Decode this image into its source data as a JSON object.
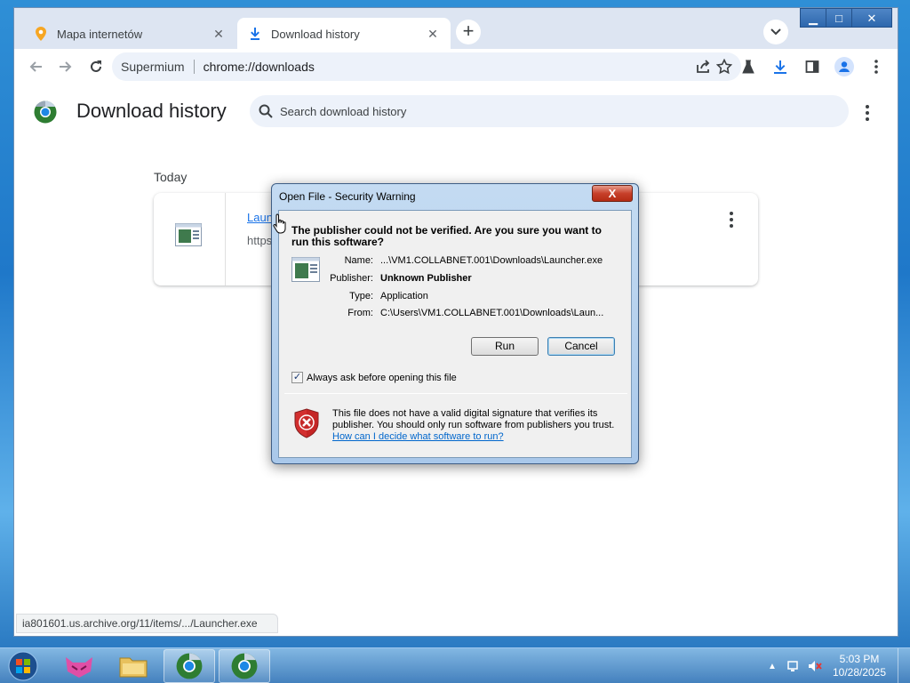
{
  "tabs": [
    {
      "title": "Mapa internetów",
      "icon": "map-pin-icon",
      "active": false
    },
    {
      "title": "Download history",
      "icon": "download-icon",
      "active": true
    }
  ],
  "toolbar": {
    "site_label": "Supermium",
    "url": "chrome://downloads"
  },
  "page": {
    "title": "Download history",
    "search_placeholder": "Search download history",
    "date_group": "Today",
    "download": {
      "filename": "Laun",
      "url": "https:"
    }
  },
  "status_bar": {
    "text": "ia801601.us.archive.org/11/items/.../Launcher.exe"
  },
  "dialog": {
    "title": "Open File - Security Warning",
    "close": "X",
    "heading": "The publisher could not be verified.  Are you sure you want to run this software?",
    "fields": [
      {
        "label": "Name:",
        "value": "...\\VM1.COLLABNET.001\\Downloads\\Launcher.exe"
      },
      {
        "label": "Publisher:",
        "value": "Unknown Publisher"
      },
      {
        "label": "Type:",
        "value": "Application"
      },
      {
        "label": "From:",
        "value": "C:\\Users\\VM1.COLLABNET.001\\Downloads\\Laun..."
      }
    ],
    "run_label": "Run",
    "cancel_label": "Cancel",
    "checkbox_label": "Always ask before opening this file",
    "checkbox_checked": true,
    "warning_text": "This file does not have a valid digital signature that verifies its publisher.  You should only run software from publishers you trust.",
    "warning_link": "How can I decide what software to run?"
  },
  "taskbar": {
    "time": "5:03 PM",
    "date": "10/28/2025"
  },
  "colors": {
    "accent": "#1a73e8",
    "omnibox_bg": "#edf2fa",
    "dialog_frame": "#a9c8ea",
    "taskbar": "#4682be"
  }
}
